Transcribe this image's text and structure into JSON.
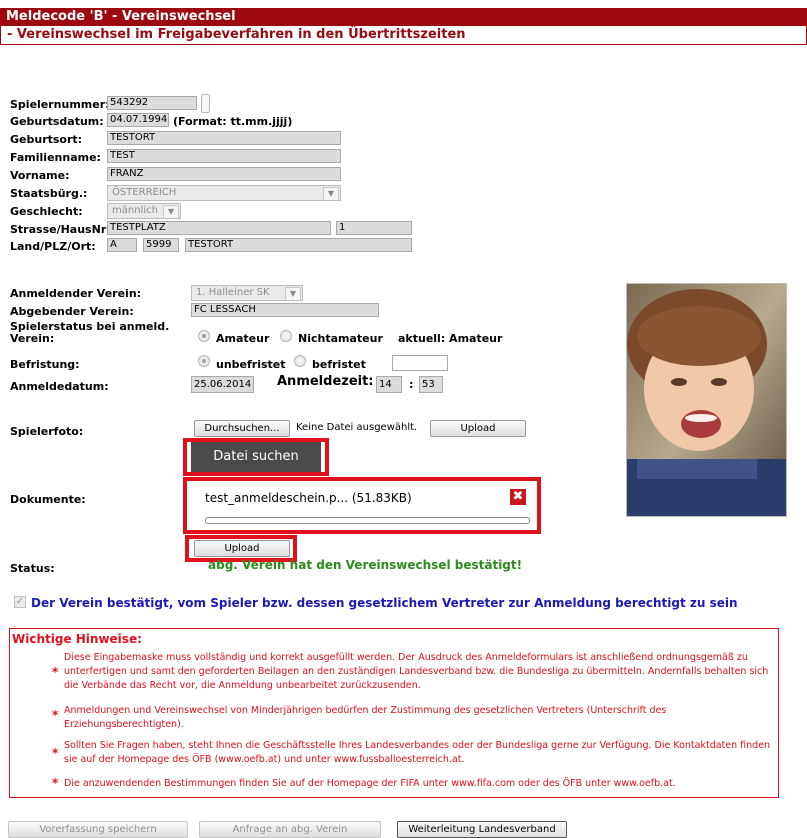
{
  "header": {
    "title": "Meldecode 'B' - Vereinswechsel",
    "subtitle": "- Vereinswechsel im Freigabeverfahren in den Übertrittszeiten"
  },
  "player": {
    "nummer_label": "Spielernummer:",
    "nummer_value": "543292",
    "geburtsdatum_label": "Geburtsdatum:",
    "geburtsdatum_value": "04.07.1994",
    "geburtsdatum_format": "(Format: tt.mm.jjjj)",
    "geburtsort_label": "Geburtsort:",
    "geburtsort_value": "TESTORT",
    "familienname_label": "Familienname:",
    "familienname_value": "TEST",
    "vorname_label": "Vorname:",
    "vorname_value": "FRANZ",
    "staatsbuerg_label": "Staatsbürg.:",
    "staatsbuerg_value": "ÖSTERREICH",
    "geschlecht_label": "Geschlecht:",
    "geschlecht_value": "männlich",
    "strasse_label": "Strasse/HausNr:",
    "strasse_value": "TESTPLATZ",
    "hausnr_value": "1",
    "land_label": "Land/PLZ/Ort:",
    "land_value": "A",
    "plz_value": "5999",
    "ort_value": "TESTORT"
  },
  "transfer": {
    "anmeldender_label": "Anmeldender Verein:",
    "anmeldender_value": "1. Halleiner SK",
    "abgebender_label": "Abgebender Verein:",
    "abgebender_value": "FC LESSACH",
    "status_label": "Spielerstatus bei anmeld. Verein:",
    "amateur_label": "Amateur",
    "nichtamateur_label": "Nichtamateur",
    "aktuell_label": "aktuell: Amateur",
    "befristung_label": "Befristung:",
    "unbefristet_label": "unbefristet",
    "befristet_label": "befristet",
    "anmeldedatum_label": "Anmeldedatum:",
    "anmeldedatum_value": "25.06.2014",
    "anmeldezeit_label": "Anmeldezeit:",
    "stunde_value": "14",
    "zeit_sep": ":",
    "minute_value": "53"
  },
  "foto": {
    "label": "Spielerfoto:",
    "browse_label": "Durchsuchen...",
    "no_file_text": "Keine Datei ausgewählt.",
    "upload_label": "Upload"
  },
  "dokumente": {
    "datei_suchen_label": "Datei suchen",
    "label": "Dokumente:",
    "file_name": "test_anmeldeschein.p... (51.83KB)",
    "upload_progress": 0,
    "upload_label": "Upload"
  },
  "status": {
    "label": "Status:",
    "value": "abg. Verein hat den Vereinswechsel bestätigt!"
  },
  "confirm": {
    "text": "Der Verein bestätigt, vom Spieler bzw. dessen gesetzlichem Vertreter zur Anmeldung berechtigt zu sein",
    "checked": true
  },
  "hints": {
    "title": "Wichtige Hinweise:",
    "items": [
      "Diese Eingabemaske muss vollständig und korrekt ausgefüllt werden. Der Ausdruck des Anmeldeformulars ist anschließend ordnungsgemäß zu unterfertigen und samt den geforderten Beilagen an den zuständigen Landesverband bzw. die Bundesliga zu übermitteln. Andernfalls behalten sich die Verbände das Recht vor, die Anmeldung unbearbeitet zurückzusenden.",
      "Anmeldungen und Vereinswechsel von Minderjährigen bedürfen der Zustimmung des gesetzlichen Vertreters (Unterschrift des Erziehungsberechtigten).",
      "Sollten Sie Fragen haben, steht Ihnen die Geschäftsstelle Ihres Landesverbandes oder der Bundesliga gerne zur Verfügung. Die Kontaktdaten finden sie auf der Homepage des ÖFB (www.oefb.at) und unter www.fussballoesterreich.at.",
      "Die anzuwendenden Bestimmungen finden Sie auf der Homepage der FIFA unter www.fifa.com oder des ÖFB unter www.oefb.at."
    ]
  },
  "buttons": {
    "vorerfassung": "Vorerfassung speichern",
    "anfrage": "Anfrage an abg. Verein",
    "weiterleitung": "Weiterleitung Landesverband"
  },
  "colors": {
    "brand": "#9c0a0f",
    "alert": "#e0101c",
    "ok": "#2e8b1e",
    "link": "#1a1ab5"
  }
}
